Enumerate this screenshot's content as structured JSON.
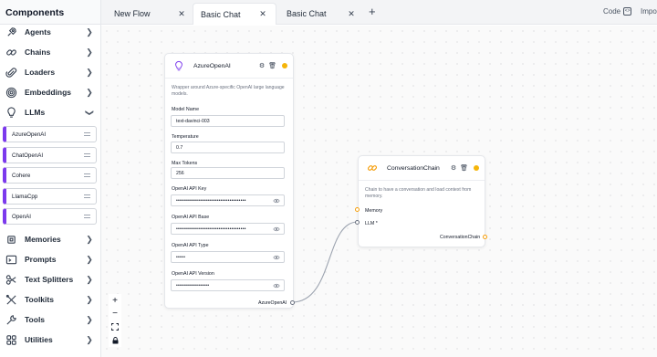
{
  "sidebar": {
    "title": "Components",
    "categories": [
      {
        "label": "Agents",
        "icon": "robot-icon"
      },
      {
        "label": "Chains",
        "icon": "link-icon"
      },
      {
        "label": "Loaders",
        "icon": "paperclip-icon"
      },
      {
        "label": "Embeddings",
        "icon": "fingerprint-icon"
      },
      {
        "label": "LLMs",
        "icon": "lightbulb-icon",
        "expanded": true
      },
      {
        "label": "Memories",
        "icon": "cpu-icon"
      },
      {
        "label": "Prompts",
        "icon": "terminal-icon"
      },
      {
        "label": "Text Splitters",
        "icon": "scissors-icon"
      },
      {
        "label": "Toolkits",
        "icon": "tools-icon"
      },
      {
        "label": "Tools",
        "icon": "wrench-icon"
      },
      {
        "label": "Utilities",
        "icon": "grid-icon"
      }
    ],
    "llm_items": [
      "AzureOpenAI",
      "ChatOpenAI",
      "Cohere",
      "LlamaCpp",
      "OpenAI"
    ]
  },
  "tabs": [
    {
      "label": "New Flow",
      "active": false
    },
    {
      "label": "Basic Chat",
      "active": true
    },
    {
      "label": "Basic Chat",
      "active": false
    }
  ],
  "toolbar": {
    "code_label": "Code",
    "import_label": "Impo"
  },
  "azure_node": {
    "title": "AzureOpenAI",
    "description": "Wrapper around Azure-specific OpenAI large language models.",
    "fields": [
      {
        "label": "Model Name",
        "value": "text-davinci-003"
      },
      {
        "label": "Temperature",
        "value": "0.7"
      },
      {
        "label": "Max Tokens",
        "value": "256"
      },
      {
        "label": "OpenAI API Key",
        "value": "••••••••••••••••••••••••••••••••••••••"
      },
      {
        "label": "OpenAI API Base",
        "value": "••••••••••••••••••••••••••••••••••••••"
      },
      {
        "label": "OpenAI API Type",
        "value": "•••••"
      },
      {
        "label": "OpenAI API Version",
        "value": "••••••••••••••••••"
      }
    ],
    "output": "AzureOpenAI"
  },
  "chain_node": {
    "title": "ConversationChain",
    "description": "Chain to have a conversation and load context from memory.",
    "inputs": [
      "Memory",
      "LLM *"
    ],
    "output": "ConversationChain"
  },
  "colors": {
    "accent": "#f59e0b",
    "sidebar_item_border": "#7c3aed"
  }
}
